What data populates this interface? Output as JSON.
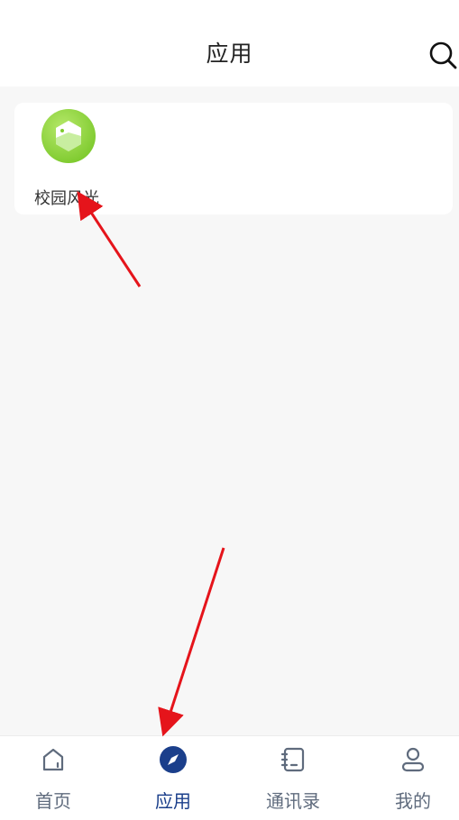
{
  "header": {
    "title": "应用",
    "search_icon": "search-icon"
  },
  "apps": [
    {
      "label": "校园风光",
      "icon": "landscape-icon",
      "colors": {
        "outer": "#8dd63a",
        "inner": "#dff5c0"
      }
    }
  ],
  "tabbar": {
    "active_color": "#1b3f8b",
    "inactive_color": "#5f6b7d",
    "tabs": [
      {
        "label": "首页",
        "icon": "home-icon",
        "active": false
      },
      {
        "label": "应用",
        "icon": "compass-icon",
        "active": true
      },
      {
        "label": "通讯录",
        "icon": "contacts-icon",
        "active": false
      },
      {
        "label": "我的",
        "icon": "user-icon",
        "active": false
      }
    ]
  },
  "annotation_color": "#e5141b"
}
